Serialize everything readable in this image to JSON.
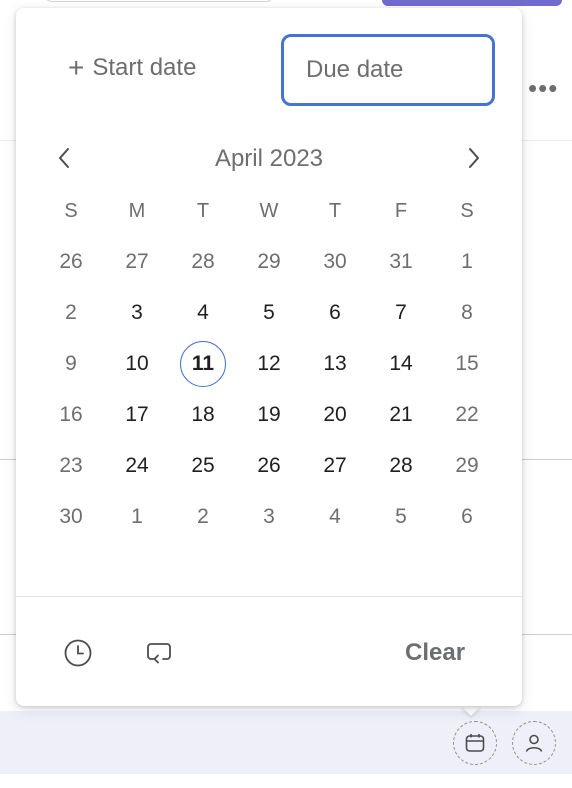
{
  "popover": {
    "start_date_label": "Start date",
    "due_date_placeholder": "Due date",
    "clear_label": "Clear"
  },
  "calendar": {
    "month_label": "April 2023",
    "weekdays": [
      "S",
      "M",
      "T",
      "W",
      "T",
      "F",
      "S"
    ],
    "weeks": [
      [
        {
          "d": "26",
          "m": true
        },
        {
          "d": "27",
          "m": true
        },
        {
          "d": "28",
          "m": true
        },
        {
          "d": "29",
          "m": true
        },
        {
          "d": "30",
          "m": true
        },
        {
          "d": "31",
          "m": true
        },
        {
          "d": "1",
          "m": true
        }
      ],
      [
        {
          "d": "2",
          "m": true
        },
        {
          "d": "3",
          "m": false
        },
        {
          "d": "4",
          "m": false
        },
        {
          "d": "5",
          "m": false
        },
        {
          "d": "6",
          "m": false
        },
        {
          "d": "7",
          "m": false
        },
        {
          "d": "8",
          "m": true
        }
      ],
      [
        {
          "d": "9",
          "m": true
        },
        {
          "d": "10",
          "m": false
        },
        {
          "d": "11",
          "m": false,
          "today": true
        },
        {
          "d": "12",
          "m": false
        },
        {
          "d": "13",
          "m": false
        },
        {
          "d": "14",
          "m": false
        },
        {
          "d": "15",
          "m": true
        }
      ],
      [
        {
          "d": "16",
          "m": true
        },
        {
          "d": "17",
          "m": false
        },
        {
          "d": "18",
          "m": false
        },
        {
          "d": "19",
          "m": false
        },
        {
          "d": "20",
          "m": false
        },
        {
          "d": "21",
          "m": false
        },
        {
          "d": "22",
          "m": true
        }
      ],
      [
        {
          "d": "23",
          "m": true
        },
        {
          "d": "24",
          "m": false
        },
        {
          "d": "25",
          "m": false
        },
        {
          "d": "26",
          "m": false
        },
        {
          "d": "27",
          "m": false
        },
        {
          "d": "28",
          "m": false
        },
        {
          "d": "29",
          "m": true
        }
      ],
      [
        {
          "d": "30",
          "m": true
        },
        {
          "d": "1",
          "m": true
        },
        {
          "d": "2",
          "m": true
        },
        {
          "d": "3",
          "m": true
        },
        {
          "d": "4",
          "m": true
        },
        {
          "d": "5",
          "m": true
        },
        {
          "d": "6",
          "m": true
        }
      ]
    ]
  },
  "icons": {
    "prev": "chevron-left-icon",
    "next": "chevron-right-icon",
    "time": "clock-icon",
    "repeat": "repeat-icon",
    "more": "more-horizontal-icon",
    "calendar": "calendar-icon",
    "assignee": "user-icon"
  },
  "colors": {
    "accent": "#4573d2",
    "muted_text": "#6d6e6f",
    "text": "#1e1f21",
    "footer_bg": "#efeffa",
    "brand_button": "#6f6bcf"
  }
}
